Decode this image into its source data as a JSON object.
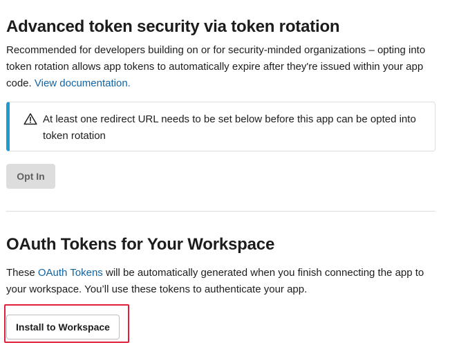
{
  "token_rotation": {
    "title": "Advanced token security via token rotation",
    "description": "Recommended for developers building on or for security-minded organizations – opting into token rotation allows app tokens to automatically expire after they're issued within your app code.",
    "doc_link": "View documentation.",
    "alert": {
      "icon": "warning-triangle-icon",
      "text": "At least one redirect URL needs to be set below before this app can be opted into token rotation"
    },
    "opt_in_label": "Opt In"
  },
  "oauth_tokens": {
    "title": "OAuth Tokens for Your Workspace",
    "description_before": "These ",
    "link": "OAuth Tokens",
    "description_after": " will be automatically generated when you finish connecting the app to your workspace. You’ll use these tokens to authenticate your app.",
    "install_label": "Install to Workspace"
  },
  "colors": {
    "alert_accent": "#1f9bcf",
    "link": "#1264a3",
    "highlight": "#e01e38"
  }
}
